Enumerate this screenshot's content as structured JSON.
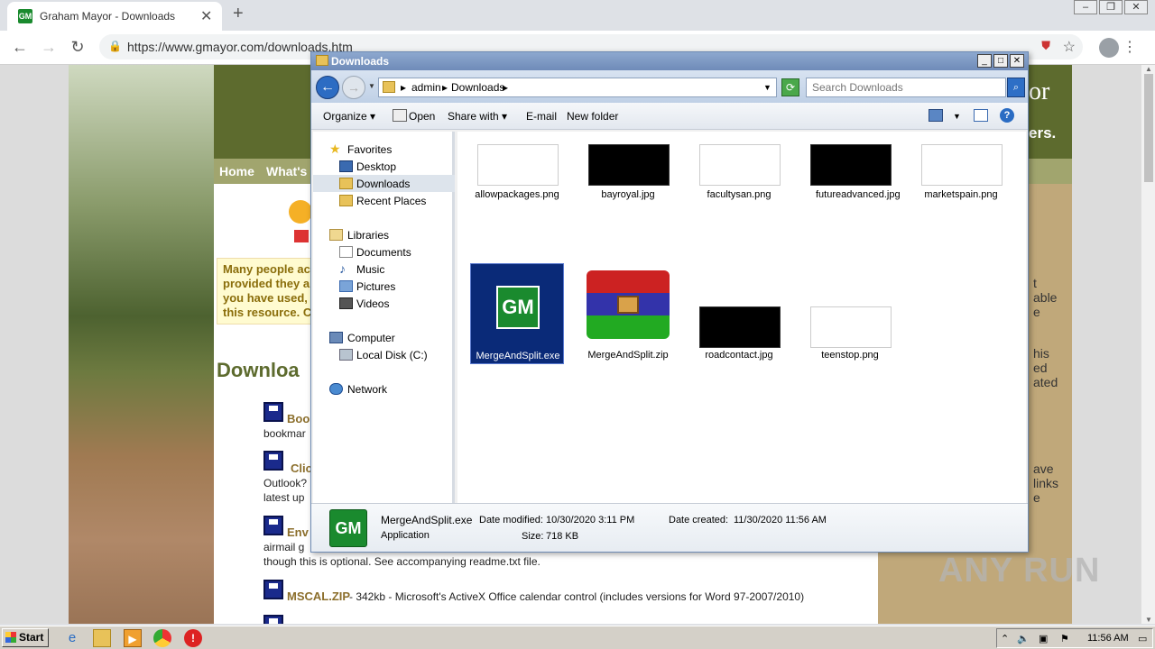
{
  "browser": {
    "tab_title": "Graham Mayor - Downloads",
    "tab_favicon": "GM",
    "url": "https://www.gmayor.com/downloads.htm"
  },
  "site": {
    "brand_line1": "or",
    "brand_line2": "ers.",
    "nav": [
      "Home",
      "What's"
    ],
    "notice_lines": [
      "Many people ac",
      "provided they a",
      "you have used,",
      "this resource. C"
    ],
    "heading": "Downloa",
    "side_lines": [
      "t",
      "able",
      "e",
      "his",
      "ed",
      "ated",
      "ave",
      "links",
      "e"
    ],
    "items": [
      {
        "title": "Boo",
        "text": "bookmar"
      },
      {
        "title": "Clic",
        "text": "Outlook?",
        "text2": "latest up"
      },
      {
        "title": "Env",
        "text": "airmail g",
        "text2": "though this is optional. See accompanying readme.txt file."
      },
      {
        "title": "MSCAL.ZIP",
        "text": " - 342kb - Microsoft's ActiveX Office calendar control (includes versions for Word 97-2007/2010)"
      }
    ]
  },
  "explorer": {
    "window_title": "Downloads",
    "breadcrumb": [
      "admin",
      "Downloads"
    ],
    "search_placeholder": "Search Downloads",
    "commands": {
      "organize": "Organize",
      "open": "Open",
      "share": "Share with",
      "email": "E-mail",
      "newfolder": "New folder"
    },
    "nav": {
      "favorites": "Favorites",
      "desktop": "Desktop",
      "downloads": "Downloads",
      "recent": "Recent Places",
      "libraries": "Libraries",
      "documents": "Documents",
      "music": "Music",
      "pictures": "Pictures",
      "videos": "Videos",
      "computer": "Computer",
      "localdisk": "Local Disk (C:)",
      "network": "Network"
    },
    "files": [
      {
        "name": "allowpackages.png",
        "thumb": "white"
      },
      {
        "name": "bayroyal.jpg",
        "thumb": "black"
      },
      {
        "name": "facultysan.png",
        "thumb": "white"
      },
      {
        "name": "futureadvanced.jpg",
        "thumb": "black"
      },
      {
        "name": "marketspain.png",
        "thumb": "white"
      },
      {
        "name": "MergeAndSplit.exe",
        "thumb": "gm-icon"
      },
      {
        "name": "MergeAndSplit.zip",
        "thumb": "archive-icon"
      },
      {
        "name": "roadcontact.jpg",
        "thumb": "black"
      },
      {
        "name": "teenstop.png",
        "thumb": "white"
      }
    ],
    "details": {
      "name": "MergeAndSplit.exe",
      "type": "Application",
      "modified_label": "Date modified:",
      "modified": "10/30/2020 3:11 PM",
      "size_label": "Size:",
      "size": "718 KB",
      "created_label": "Date created:",
      "created": "11/30/2020 11:56 AM"
    }
  },
  "taskbar": {
    "start": "Start",
    "clock": "11:56 AM"
  },
  "watermark": "ANY RUN"
}
